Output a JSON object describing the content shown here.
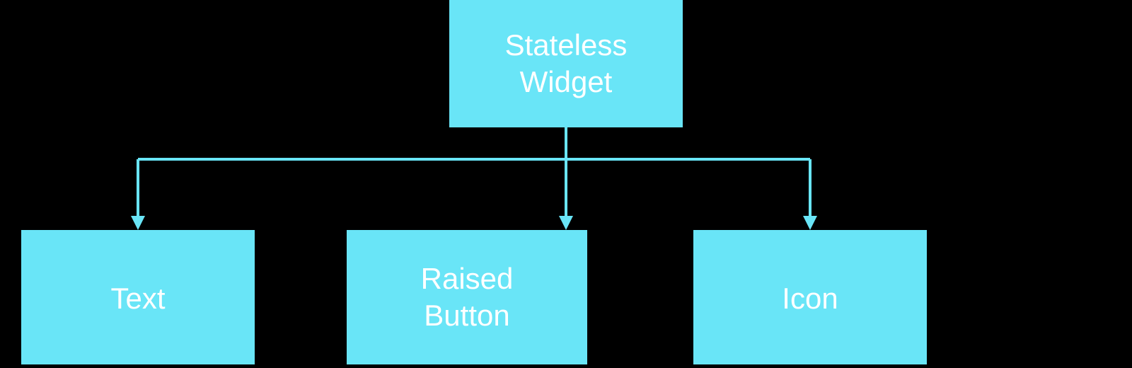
{
  "colors": {
    "background": "#000000",
    "node_fill": "#69e5f7",
    "node_text": "#ffffff",
    "arrow": "#69e5f7"
  },
  "diagram": {
    "root": {
      "label_line1": "Stateless",
      "label_line2": "Widget"
    },
    "children": [
      {
        "label_line1": "Text",
        "label_line2": ""
      },
      {
        "label_line1": "Raised",
        "label_line2": "Button"
      },
      {
        "label_line1": "Icon",
        "label_line2": ""
      }
    ]
  }
}
